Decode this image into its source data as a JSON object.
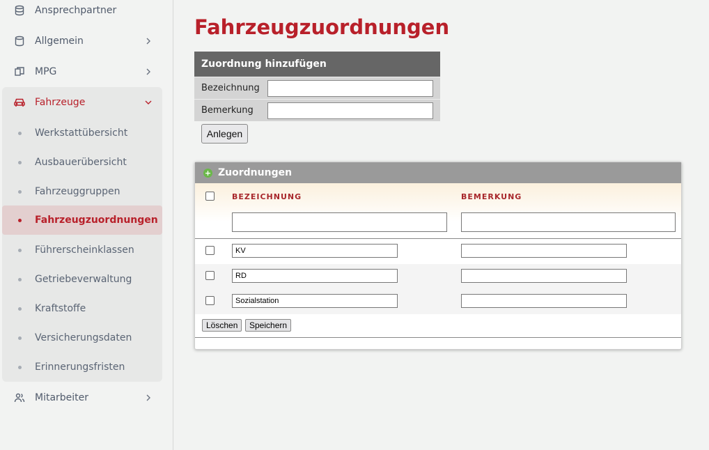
{
  "sidebar": {
    "items": [
      {
        "label": "Ansprechpartner",
        "icon": "database-icon"
      },
      {
        "label": "Allgemein",
        "icon": "database-icon"
      },
      {
        "label": "MPG",
        "icon": "copy-icon"
      },
      {
        "label": "Fahrzeuge",
        "icon": "car-icon"
      },
      {
        "label": "Mitarbeiter",
        "icon": "users-icon"
      }
    ],
    "sub_items": [
      {
        "label": "Werkstattübersicht"
      },
      {
        "label": "Ausbauerübersicht"
      },
      {
        "label": "Fahrzeuggruppen"
      },
      {
        "label": "Fahrzeugzuordnungen"
      },
      {
        "label": "Führerscheinklassen"
      },
      {
        "label": "Getriebeverwaltung"
      },
      {
        "label": "Kraftstoffe"
      },
      {
        "label": "Versicherungsdaten"
      },
      {
        "label": "Erinnerungsfristen"
      }
    ],
    "active_sub": "Fahrzeugzuordnungen"
  },
  "page": {
    "title": "Fahrzeugzuordnungen"
  },
  "add_form": {
    "header": "Zuordnung hinzufügen",
    "fields": [
      {
        "label": "Bezeichnung",
        "value": ""
      },
      {
        "label": "Bemerkung",
        "value": ""
      }
    ],
    "submit_label": "Anlegen"
  },
  "grid": {
    "title": "Zuordnungen",
    "columns": [
      "BEZEICHNUNG",
      "BEMERKUNG"
    ],
    "filters": {
      "bezeichnung": "",
      "bemerkung": ""
    },
    "rows": [
      {
        "bezeichnung": "KV",
        "bemerkung": ""
      },
      {
        "bezeichnung": "RD",
        "bemerkung": ""
      },
      {
        "bezeichnung": "Sozialstation",
        "bemerkung": ""
      }
    ],
    "delete_label": "Löschen",
    "save_label": "Speichern"
  },
  "colors": {
    "accent": "#b8202a",
    "sidebar_bg": "#f2f3f2",
    "active_bg": "#e3cfcf"
  }
}
